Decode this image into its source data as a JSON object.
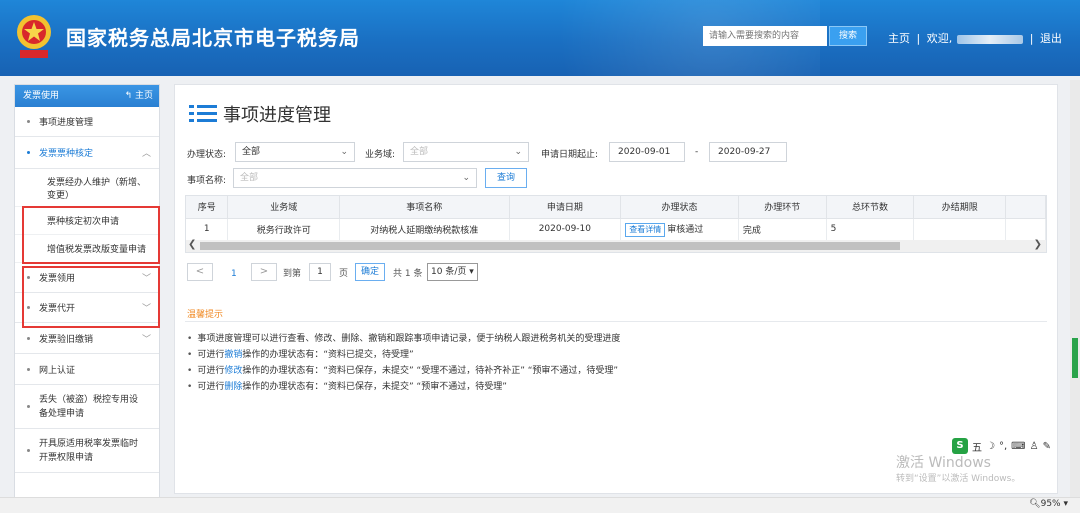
{
  "header": {
    "title": "国家税务总局北京市电子税务局",
    "search_placeholder": "请输入需要搜索的内容",
    "search_button": "搜索",
    "links": {
      "home": "主页",
      "sep": "|",
      "welcome": "欢迎,",
      "logout": "退出"
    }
  },
  "sidebar": {
    "header_label": "发票使用",
    "home_label": "主页",
    "items": [
      {
        "label": "事项进度管理"
      },
      {
        "label": "发票票种核定"
      },
      {
        "label": "发票领用"
      },
      {
        "label": "发票代开"
      },
      {
        "label": "发票验旧缴销"
      },
      {
        "label": "网上认证"
      },
      {
        "label": "丢失（被盗）税控专用设备处理申请"
      },
      {
        "label": "开具原适用税率发票临时开票权限申请"
      }
    ],
    "sub_items": [
      {
        "label": "发票经办人维护（新增、变更）"
      },
      {
        "label": "票种核定初次申请"
      },
      {
        "label": "增值税发票改版变量申请"
      }
    ]
  },
  "main": {
    "title": "事项进度管理",
    "filters": {
      "status_label": "办理状态:",
      "status_value": "全部",
      "domain_label": "业务域:",
      "domain_value": "全部",
      "date_label": "申请日期起止:",
      "date_start": "2020-09-01",
      "date_sep": "-",
      "date_end": "2020-09-27",
      "name_label": "事项名称:",
      "name_value": "全部",
      "query_button": "查询"
    },
    "table": {
      "columns": [
        "序号",
        "业务域",
        "事项名称",
        "申请日期",
        "办理状态",
        "办理环节",
        "总环节数",
        "办结期限"
      ],
      "rows": [
        [
          "1",
          "税务行政许可",
          "对纳税人延期缴纳税款核准",
          "2020-09-10",
          "审核通过",
          "完成",
          "5",
          ""
        ]
      ],
      "detail_button": "查看详情"
    },
    "pagination": {
      "prev": "<",
      "current": "1",
      "next": ">",
      "goto_label": "到第",
      "goto_value": "1",
      "page_unit": "页",
      "ok": "确定",
      "total": "共 1 条",
      "page_size": "10 条/页"
    },
    "tips": {
      "title": "温馨提示",
      "lines": [
        {
          "text": "事项进度管理可以进行查看、修改、删除、撤销和跟踪事项申请记录，便于纳税人跟进税务机关的受理进度"
        },
        {
          "pre": "可进行",
          "hl": "撤销",
          "post": "操作的办理状态有：“资料已提交，待受理”"
        },
        {
          "pre": "可进行",
          "hl": "修改",
          "post": "操作的办理状态有：“资料已保存，未提交”  “受理不通过，待补齐补正”  “预审不通过，待受理”"
        },
        {
          "pre": "可进行",
          "hl": "删除",
          "post": "操作的办理状态有：“资料已保存，未提交”  “预审不通过，待受理”"
        }
      ]
    }
  },
  "overlay": {
    "activate_line1": "激活 Windows",
    "activate_line2": "转到“设置”以激活 Windows。",
    "ime_lang": "五",
    "zoom": "95%"
  },
  "colors": {
    "header_blue": "#1a6fc2",
    "accent": "#1c7cd6",
    "highlight_box": "#e53935",
    "tips_title": "#f08a24"
  }
}
